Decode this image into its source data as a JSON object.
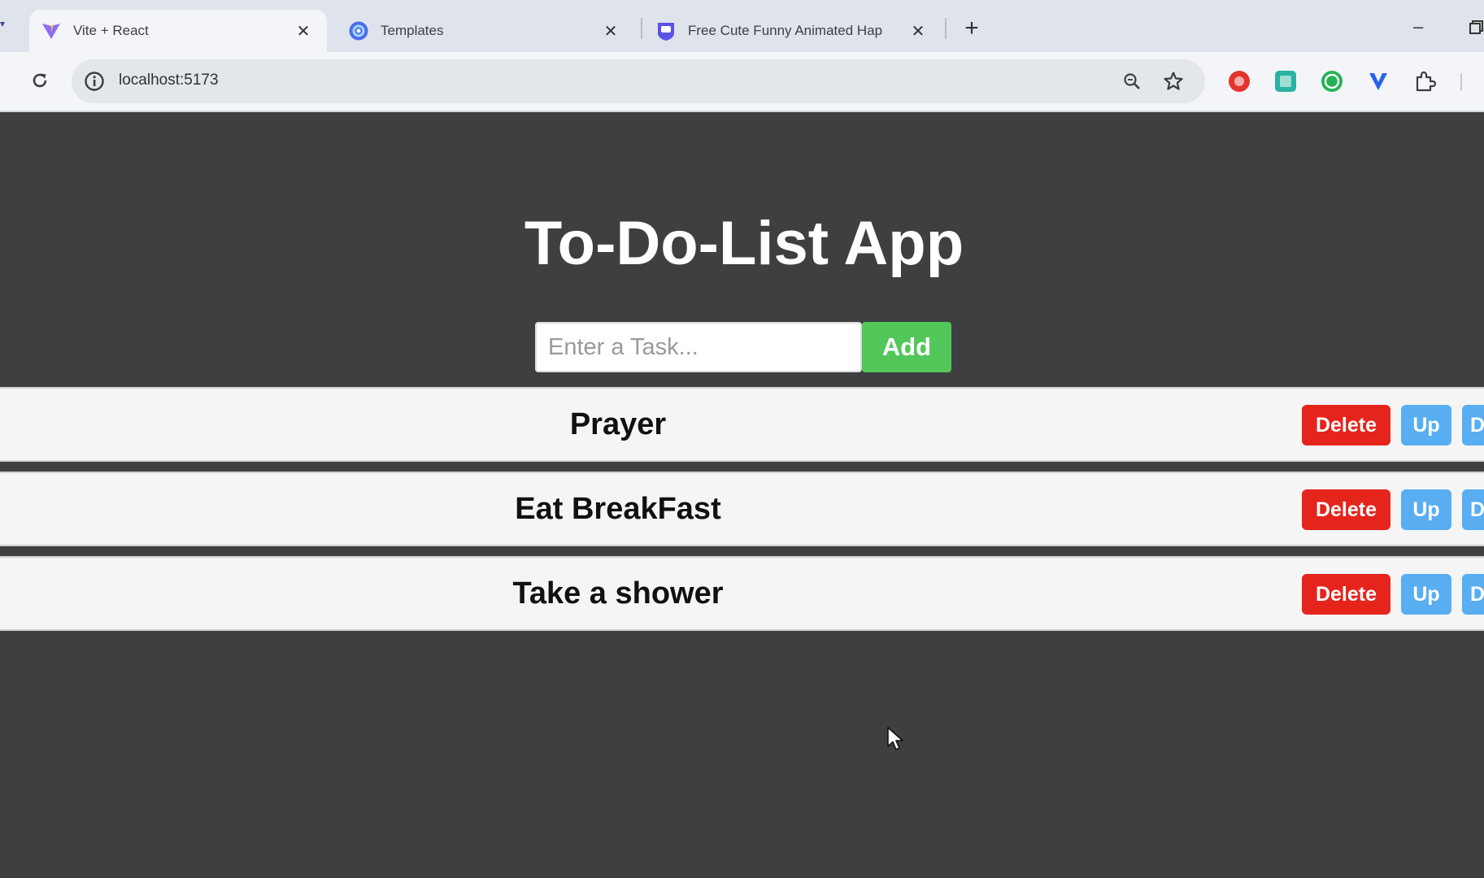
{
  "browser": {
    "tabs": [
      {
        "title": "Vite + React",
        "favicon": "vite-icon",
        "active": true
      },
      {
        "title": "Templates",
        "favicon": "globe-icon",
        "active": false
      },
      {
        "title": "Free Cute Funny Animated Hap",
        "favicon": "shield-chat-icon",
        "active": false
      }
    ],
    "close_glyph": "✕",
    "new_tab_glyph": "+",
    "minimize_glyph": "–",
    "address": {
      "url": "localhost:5173"
    }
  },
  "app": {
    "title": "To-Do-List App",
    "input": {
      "placeholder": "Enter a Task...",
      "value": ""
    },
    "add_label": "Add",
    "tasks": [
      {
        "text": "Prayer",
        "delete_label": "Delete",
        "up_label": "Up",
        "down_label": "D"
      },
      {
        "text": "Eat BreakFast",
        "delete_label": "Delete",
        "up_label": "Up",
        "down_label": "D"
      },
      {
        "text": "Take a shower",
        "delete_label": "Delete",
        "up_label": "Up",
        "down_label": "D"
      }
    ]
  },
  "colors": {
    "page_bg": "#3f3f41",
    "add_green": "#54c75a",
    "delete_red": "#e5241c",
    "move_blue": "#58aef1"
  }
}
